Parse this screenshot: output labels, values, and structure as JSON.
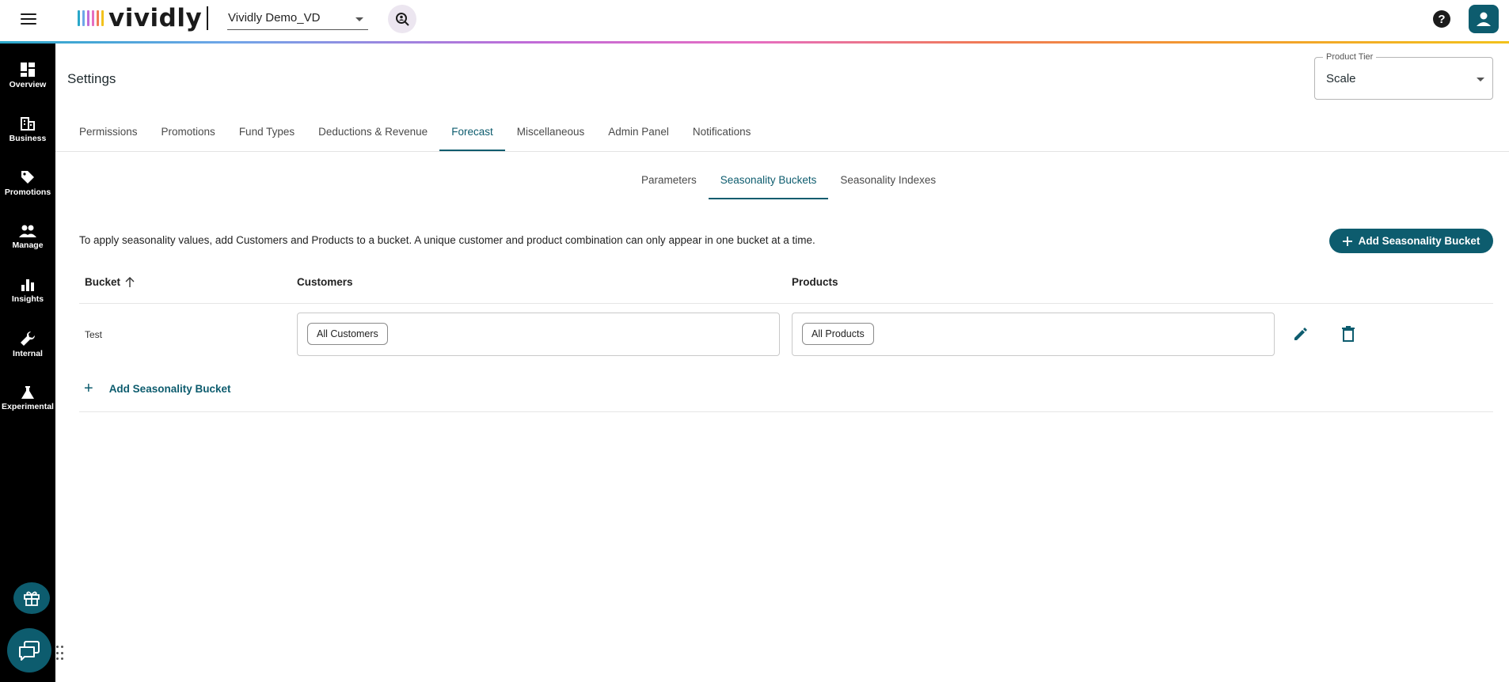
{
  "header": {
    "logo_text": "vividly",
    "account": "Vividly Demo_VD",
    "help_glyph": "?",
    "icons": [
      "menu-icon",
      "customer-search-icon",
      "help-icon",
      "user-icon"
    ]
  },
  "colors": {
    "brand": "#0d5c6e",
    "nav_bg": "#000000",
    "rainbow": [
      "#2aa7c9",
      "#c06bd8",
      "#e66ec2",
      "#f07a56",
      "#f2c21c"
    ]
  },
  "sidebar": {
    "items": [
      {
        "label": "Overview",
        "icon": "overview-icon"
      },
      {
        "label": "Business",
        "icon": "building-icon"
      },
      {
        "label": "Promotions",
        "icon": "tag-icon"
      },
      {
        "label": "Manage",
        "icon": "people-icon"
      },
      {
        "label": "Insights",
        "icon": "bar-chart-icon"
      },
      {
        "label": "Internal",
        "icon": "wrench-icon"
      },
      {
        "label": "Experimental",
        "icon": "flask-icon"
      }
    ]
  },
  "page": {
    "title": "Settings",
    "product_tier": {
      "label": "Product Tier",
      "value": "Scale"
    }
  },
  "tabs": [
    "Permissions",
    "Promotions",
    "Fund Types",
    "Deductions & Revenue",
    "Forecast",
    "Miscellaneous",
    "Admin Panel",
    "Notifications"
  ],
  "active_tab": "Forecast",
  "subtabs": [
    "Parameters",
    "Seasonality Buckets",
    "Seasonality Indexes"
  ],
  "active_subtab": "Seasonality Buckets",
  "buckets": {
    "instructions": "To apply seasonality values, add Customers and Products to a bucket. A unique customer and product combination can only appear in one bucket at a time.",
    "add_button_label": "Add Seasonality Bucket",
    "columns": {
      "bucket": "Bucket",
      "customers": "Customers",
      "products": "Products"
    },
    "sort": "ascending",
    "rows": [
      {
        "bucket": "Test",
        "customers": [
          "All Customers"
        ],
        "products": [
          "All Products"
        ]
      }
    ],
    "add_inline_label": "Add Seasonality Bucket",
    "add_inline_glyph": "+"
  }
}
